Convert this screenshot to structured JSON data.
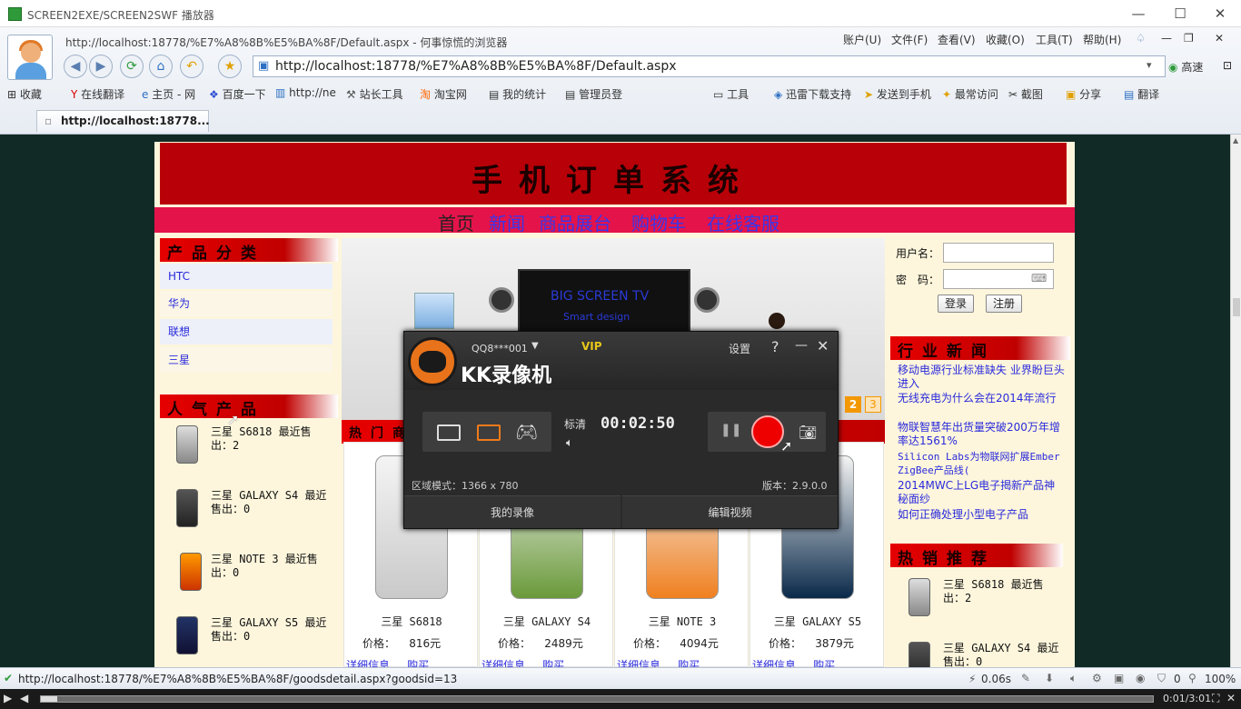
{
  "window": {
    "title": "SCREEN2EXE/SCREEN2SWF 播放器",
    "min": "—",
    "max": "☐",
    "close": "✕"
  },
  "browser": {
    "page_title": "http://localhost:18778/%E7%A8%8B%E5%BA%8F/Default.aspx - 何事惊慌的浏览器",
    "menus": [
      "账户(U)",
      "文件(F)",
      "查看(V)",
      "收藏(O)",
      "工具(T)",
      "帮助(H)"
    ],
    "address": "http://localhost:18778/%E7%A8%8B%E5%BA%8F/Default.aspx",
    "speed_label": "高速",
    "favorites": [
      "收藏",
      "在线翻译",
      "主页 - 网",
      "百度一下",
      "http://ne",
      "站长工具",
      "淘宝网",
      "我的统计",
      "管理员登"
    ],
    "tools": [
      "工具",
      "迅雷下载支持",
      "发送到手机",
      "最常访问",
      "截图",
      "分享",
      "翻译"
    ],
    "tab_title": "http://localhost:18778..."
  },
  "site": {
    "banner": "手机订单系统",
    "nav": [
      "首页",
      "新闻",
      "商品展台",
      "购物车",
      "在线客服"
    ],
    "categories_title": "产品分类",
    "categories": [
      "HTC",
      "华为",
      "联想",
      "三星"
    ],
    "hot_title": "人气产品",
    "hot_items": [
      "三星 S6818 最近售出：2",
      "三星 GALAXY S4 最近售出：0",
      "三星 NOTE 3 最近售出：0",
      "三星 GALAXY S5 最近售出：0"
    ],
    "slide_pages": [
      "2",
      "3"
    ],
    "slide_caption_1": "BIG SCREEN TV",
    "slide_caption_2": "Smart design",
    "products_title": "热门商品",
    "products": [
      {
        "name": "三星 S6818",
        "price": "816元"
      },
      {
        "name": "三星 GALAXY S4",
        "price": "2489元"
      },
      {
        "name": "三星 NOTE 3",
        "price": "4094元"
      },
      {
        "name": "三星 GALAXY S5",
        "price": "3879元"
      }
    ],
    "price_label": "价格：",
    "detail_link": "详细信息",
    "buy_link": "购买",
    "login": {
      "user_label": "用户名：",
      "pwd_label": "密　码：",
      "login_btn": "登录",
      "register_btn": "注册"
    },
    "news_title": "行业新闻",
    "news": [
      "移动电源行业标准缺失 业界盼巨头进入",
      "无线充电为什么会在2014年流行",
      "物联智慧年出货量突破200万年增率达1561%",
      "Silicon Labs为物联网扩展Ember ZigBee产品线(",
      "2014MWC上LG电子揭新产品神秘面纱",
      "如何正确处理小型电子产品"
    ],
    "bestseller_title": "热销推荐",
    "bestsellers": [
      "三星 S6818 最近售出：2",
      "三星 GALAXY S4 最近售出：0"
    ]
  },
  "recorder": {
    "account": "QQ8***001",
    "vip": "VIP",
    "settings": "设置",
    "help": "?",
    "brand": "KK录像机",
    "quality": "标清",
    "timer": "00:02:50",
    "mode": "区域模式：1366 x 780",
    "version": "版本：2.9.0.0",
    "my_videos": "我的录像",
    "edit_video": "编辑视频"
  },
  "status": {
    "url": "http://localhost:18778/%E7%A8%8B%E5%BA%8F/goodsdetail.aspx?goodsid=13",
    "speed": "0.06s",
    "count": "0",
    "zoom": "100%"
  },
  "player": {
    "time": "0:01/3:01"
  }
}
